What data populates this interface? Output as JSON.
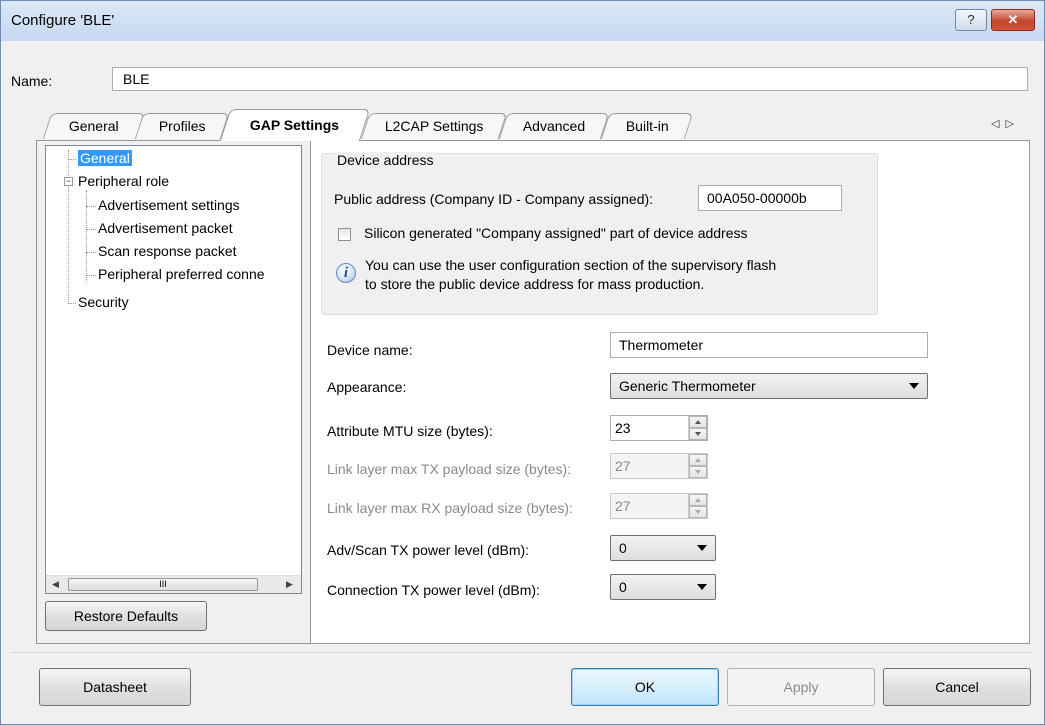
{
  "window": {
    "title": "Configure 'BLE'",
    "help_label": "?",
    "close_label": "✕"
  },
  "name_field": {
    "label": "Name:",
    "value": "BLE"
  },
  "tabs": [
    {
      "label": "General",
      "active": false
    },
    {
      "label": "Profiles",
      "active": false
    },
    {
      "label": "GAP Settings",
      "active": true
    },
    {
      "label": "L2CAP Settings",
      "active": false
    },
    {
      "label": "Advanced",
      "active": false
    },
    {
      "label": "Built-in",
      "active": false
    }
  ],
  "tab_scroll": {
    "left": "◁",
    "right": "▷"
  },
  "tree": {
    "items": [
      {
        "label": "General",
        "selected": true
      },
      {
        "label": "Peripheral role",
        "expander": "−"
      },
      {
        "label": "Advertisement settings"
      },
      {
        "label": "Advertisement packet"
      },
      {
        "label": "Scan response packet"
      },
      {
        "label": "Peripheral preferred conne"
      },
      {
        "label": "Security"
      }
    ],
    "scroll_left": "◀",
    "scroll_right": "▶",
    "scroll_grip": "III"
  },
  "restore_defaults_label": "Restore Defaults",
  "device_address": {
    "title": "Device address",
    "public_address_label": "Public address (Company ID - Company assigned):",
    "public_address_value": "00A050-00000b",
    "silicon_checkbox_label": "Silicon generated \"Company assigned\" part of device address",
    "silicon_checked": false,
    "info_icon": "i",
    "info_line1": "You can use the user configuration section of the supervisory flash",
    "info_line2": "to store the public device address for mass production."
  },
  "settings": {
    "device_name_label": "Device name:",
    "device_name_value": "Thermometer",
    "appearance_label": "Appearance:",
    "appearance_value": "Generic Thermometer",
    "mtu_label": "Attribute MTU size (bytes):",
    "mtu_value": "23",
    "tx_payload_label": "Link layer max TX payload size (bytes):",
    "tx_payload_value": "27",
    "rx_payload_label": "Link layer max RX payload size (bytes):",
    "rx_payload_value": "27",
    "adv_power_label": "Adv/Scan TX power level (dBm):",
    "adv_power_value": "0",
    "conn_power_label": "Connection TX power level (dBm):",
    "conn_power_value": "0"
  },
  "footer": {
    "datasheet_label": "Datasheet",
    "ok_label": "OK",
    "apply_label": "Apply",
    "cancel_label": "Cancel"
  },
  "colors": {
    "selection": "#3399ff",
    "close_button": "#c3452d",
    "titlebar": "#c6d9f1"
  }
}
